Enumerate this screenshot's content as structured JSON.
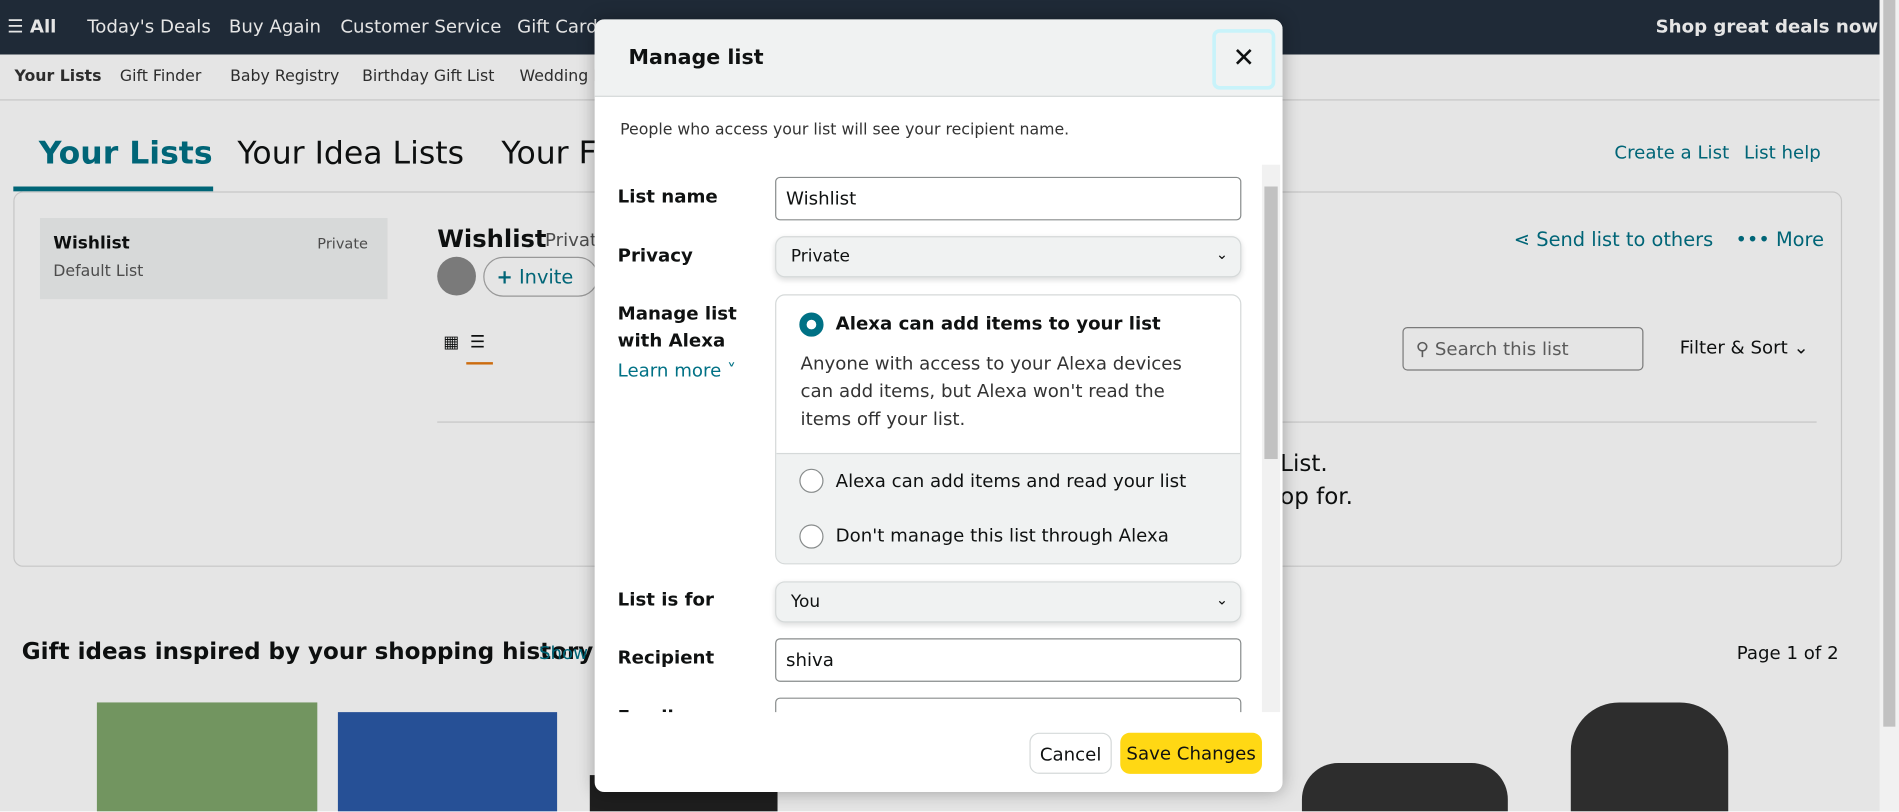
{
  "topnav": {
    "all": "All",
    "items": [
      "Today's Deals",
      "Buy Again",
      "Customer Service",
      "Gift Cards"
    ],
    "promo": "Shop great deals now"
  },
  "subnav": {
    "items": [
      "Your Lists",
      "Gift Finder",
      "Baby Registry",
      "Birthday Gift List",
      "Wedding Registry"
    ]
  },
  "tabs": [
    "Your Lists",
    "Your Idea Lists",
    "Your Friends"
  ],
  "header_links": {
    "create": "Create a List",
    "help": "List help"
  },
  "sidebar_list": {
    "name": "Wishlist",
    "privacy": "Private",
    "sub": "Default List"
  },
  "list_main": {
    "title": "Wishlist",
    "privacy": "Private",
    "invite": "Invite",
    "send": "Send list to others",
    "more": "More",
    "search_placeholder": "Search this list",
    "filter": "Filter & Sort",
    "empty_line1": "List.",
    "empty_line2": "op for."
  },
  "gifts": {
    "title": "Gift ideas inspired by your shopping history",
    "show": "Show more",
    "page": "Page 1 of 2"
  },
  "modal": {
    "title": "Manage list",
    "close": "✕",
    "notice": "People who access your list will see your recipient name.",
    "list_name_label": "List name",
    "list_name_value": "Wishlist",
    "privacy_label": "Privacy",
    "privacy_value": "Private",
    "alexa_label_1": "Manage list",
    "alexa_label_2": "with Alexa",
    "learn_more": "Learn more",
    "alexa_options": [
      {
        "label": "Alexa can add items to your list",
        "selected": true,
        "desc": "Anyone with access to your Alexa devices can add items, but Alexa won't read the items off your list."
      },
      {
        "label": "Alexa can add items and read your list",
        "selected": false
      },
      {
        "label": "Don't manage this list through Alexa",
        "selected": false
      }
    ],
    "list_for_label": "List is for",
    "list_for_value": "You",
    "recipient_label": "Recipient",
    "recipient_value": "shiva",
    "email_label": "Email",
    "cancel": "Cancel",
    "save": "Save Changes"
  },
  "colors": {
    "nav": "#232f3e",
    "link": "#007185",
    "save": "#ffd814",
    "accent_tab": "#007185"
  }
}
